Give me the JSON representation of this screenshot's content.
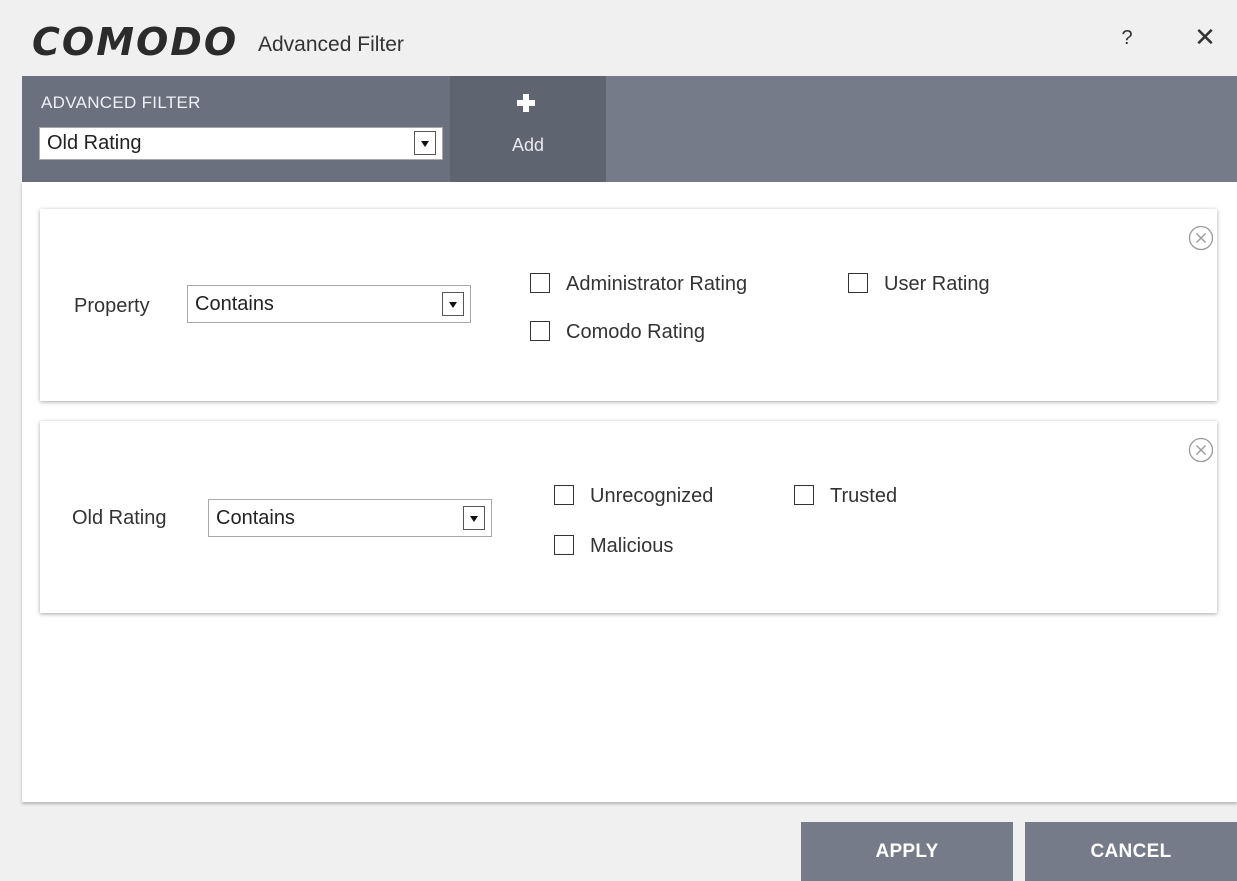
{
  "titlebar": {
    "logo": "COMODO",
    "title": "Advanced Filter",
    "help": "?",
    "close": "✕"
  },
  "header": {
    "label": "ADVANCED FILTER",
    "filter_select": "Old Rating",
    "add_label": "Add"
  },
  "filters": [
    {
      "label": "Property",
      "operator": "Contains",
      "options": [
        {
          "label": "Administrator Rating",
          "checked": false
        },
        {
          "label": "User Rating",
          "checked": false
        },
        {
          "label": "Comodo Rating",
          "checked": false
        }
      ]
    },
    {
      "label": "Old Rating",
      "operator": "Contains",
      "options": [
        {
          "label": "Unrecognized",
          "checked": false
        },
        {
          "label": "Trusted",
          "checked": false
        },
        {
          "label": "Malicious",
          "checked": false
        }
      ]
    }
  ],
  "footer": {
    "apply": "APPLY",
    "cancel": "CANCEL"
  },
  "colors": {
    "header_bg": "#767b89",
    "header_left_bg": "#6b707e",
    "add_bg": "#5f6471",
    "button_bg": "#767b89"
  }
}
